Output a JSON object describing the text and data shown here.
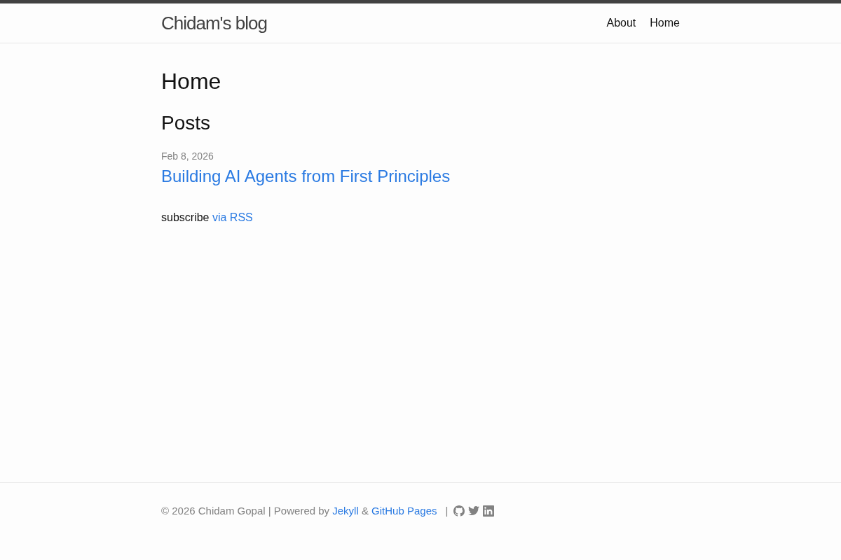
{
  "header": {
    "title": "Chidam's blog",
    "nav": [
      {
        "label": "About"
      },
      {
        "label": "Home"
      }
    ]
  },
  "page": {
    "title": "Home",
    "section_title": "Posts",
    "posts": [
      {
        "date": "Feb 8, 2026",
        "title": "Building AI Agents from First Principles"
      }
    ],
    "subscribe": {
      "text": "subscribe",
      "link": "via RSS"
    }
  },
  "footer": {
    "parts": [
      {
        "kind": "text",
        "text": "© 2026 Chidam Gopal | Powered by "
      },
      {
        "kind": "link",
        "text": "Jekyll"
      },
      {
        "kind": "text",
        "text": " & "
      },
      {
        "kind": "link",
        "text": "GitHub Pages"
      }
    ],
    "separator": "|",
    "social": [
      {
        "kind": "github"
      },
      {
        "kind": "twitter"
      },
      {
        "kind": "linkedin"
      }
    ]
  }
}
